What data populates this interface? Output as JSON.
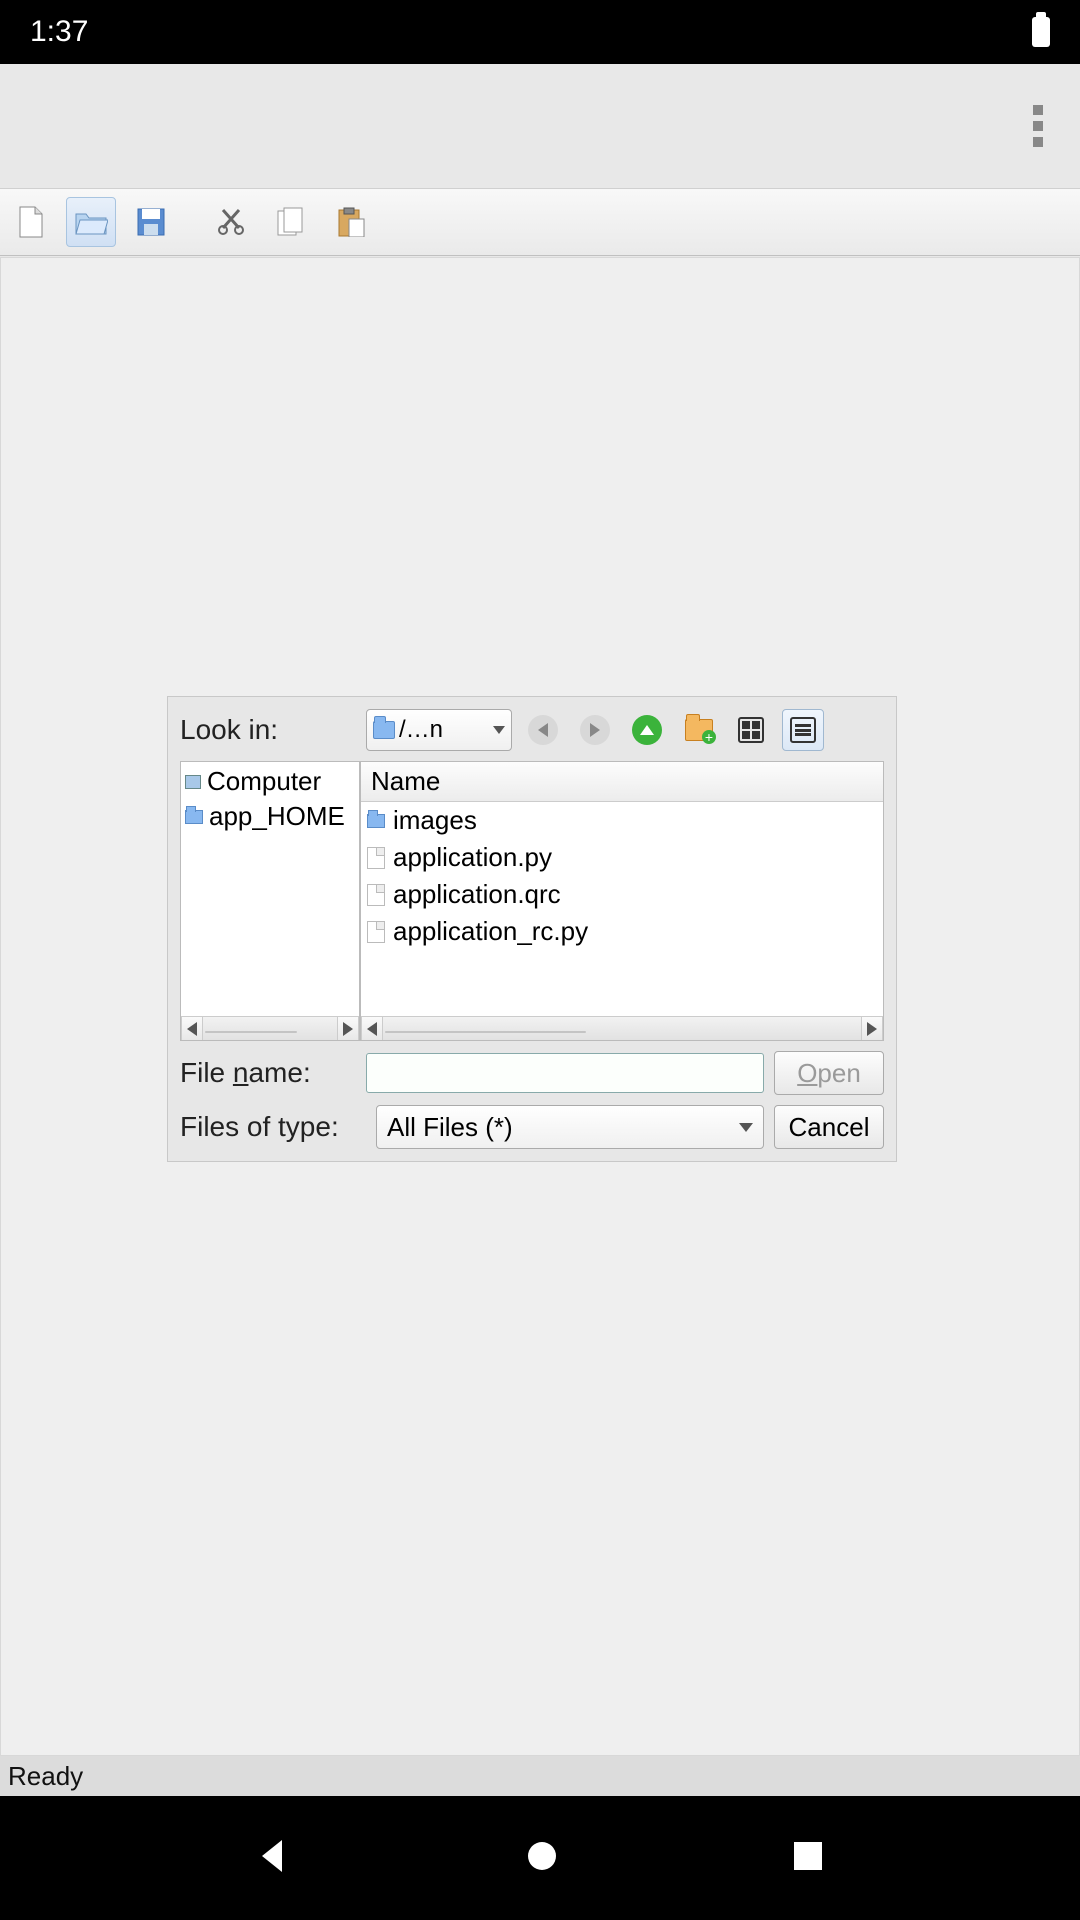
{
  "status_bar": {
    "time": "1:37"
  },
  "app": {
    "status_text": "Ready"
  },
  "dialog": {
    "look_in_label": "Look in:",
    "look_in_value": "/…n",
    "shortcuts": [
      {
        "label": "Computer",
        "kind": "computer"
      },
      {
        "label": "app_HOME",
        "kind": "folder"
      }
    ],
    "column_header": "Name",
    "files": [
      {
        "name": "images",
        "kind": "folder"
      },
      {
        "name": "application.py",
        "kind": "file"
      },
      {
        "name": "application.qrc",
        "kind": "file"
      },
      {
        "name": "application_rc.py",
        "kind": "file"
      }
    ],
    "file_name_label_pre": "File ",
    "file_name_label_ul": "n",
    "file_name_label_post": "ame:",
    "file_name_value": "",
    "files_of_type_label": "Files of type:",
    "files_of_type_value": "All Files (*)",
    "open_label_ul": "O",
    "open_label_post": "pen",
    "cancel_label": "Cancel"
  }
}
